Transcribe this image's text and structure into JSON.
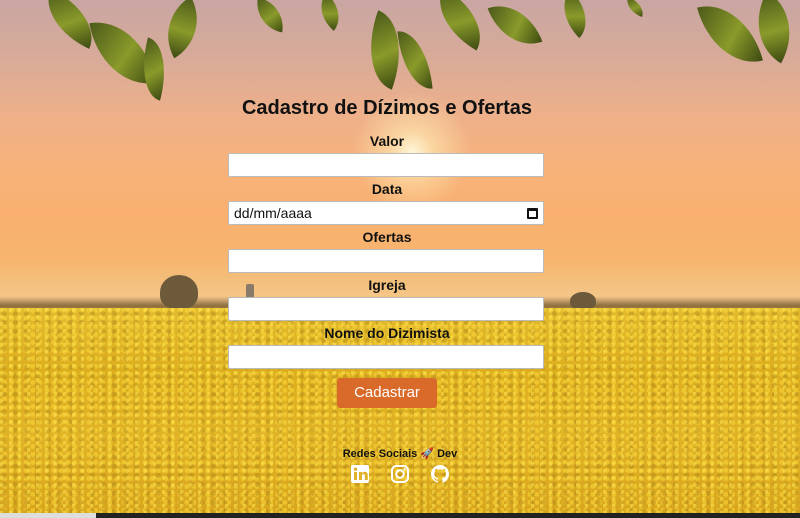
{
  "form": {
    "title": "Cadastro de Dízimos e Ofertas",
    "fields": [
      {
        "label": "Valor",
        "value": "",
        "placeholder": ""
      },
      {
        "label": "Data",
        "value": "dd/mm/aaaa",
        "placeholder": ""
      },
      {
        "label": "Ofertas",
        "value": "",
        "placeholder": ""
      },
      {
        "label": "Igreja",
        "value": "",
        "placeholder": ""
      },
      {
        "label": "Nome do Dizimista",
        "value": "",
        "placeholder": ""
      }
    ],
    "submit_label": "Cadastrar"
  },
  "footer": {
    "title": "Redes Sociais 🚀 Dev",
    "socials": [
      {
        "name": "linkedin-icon"
      },
      {
        "name": "instagram-icon"
      },
      {
        "name": "github-icon"
      }
    ]
  },
  "colors": {
    "button": "#d96a2a",
    "text": "#111111"
  }
}
